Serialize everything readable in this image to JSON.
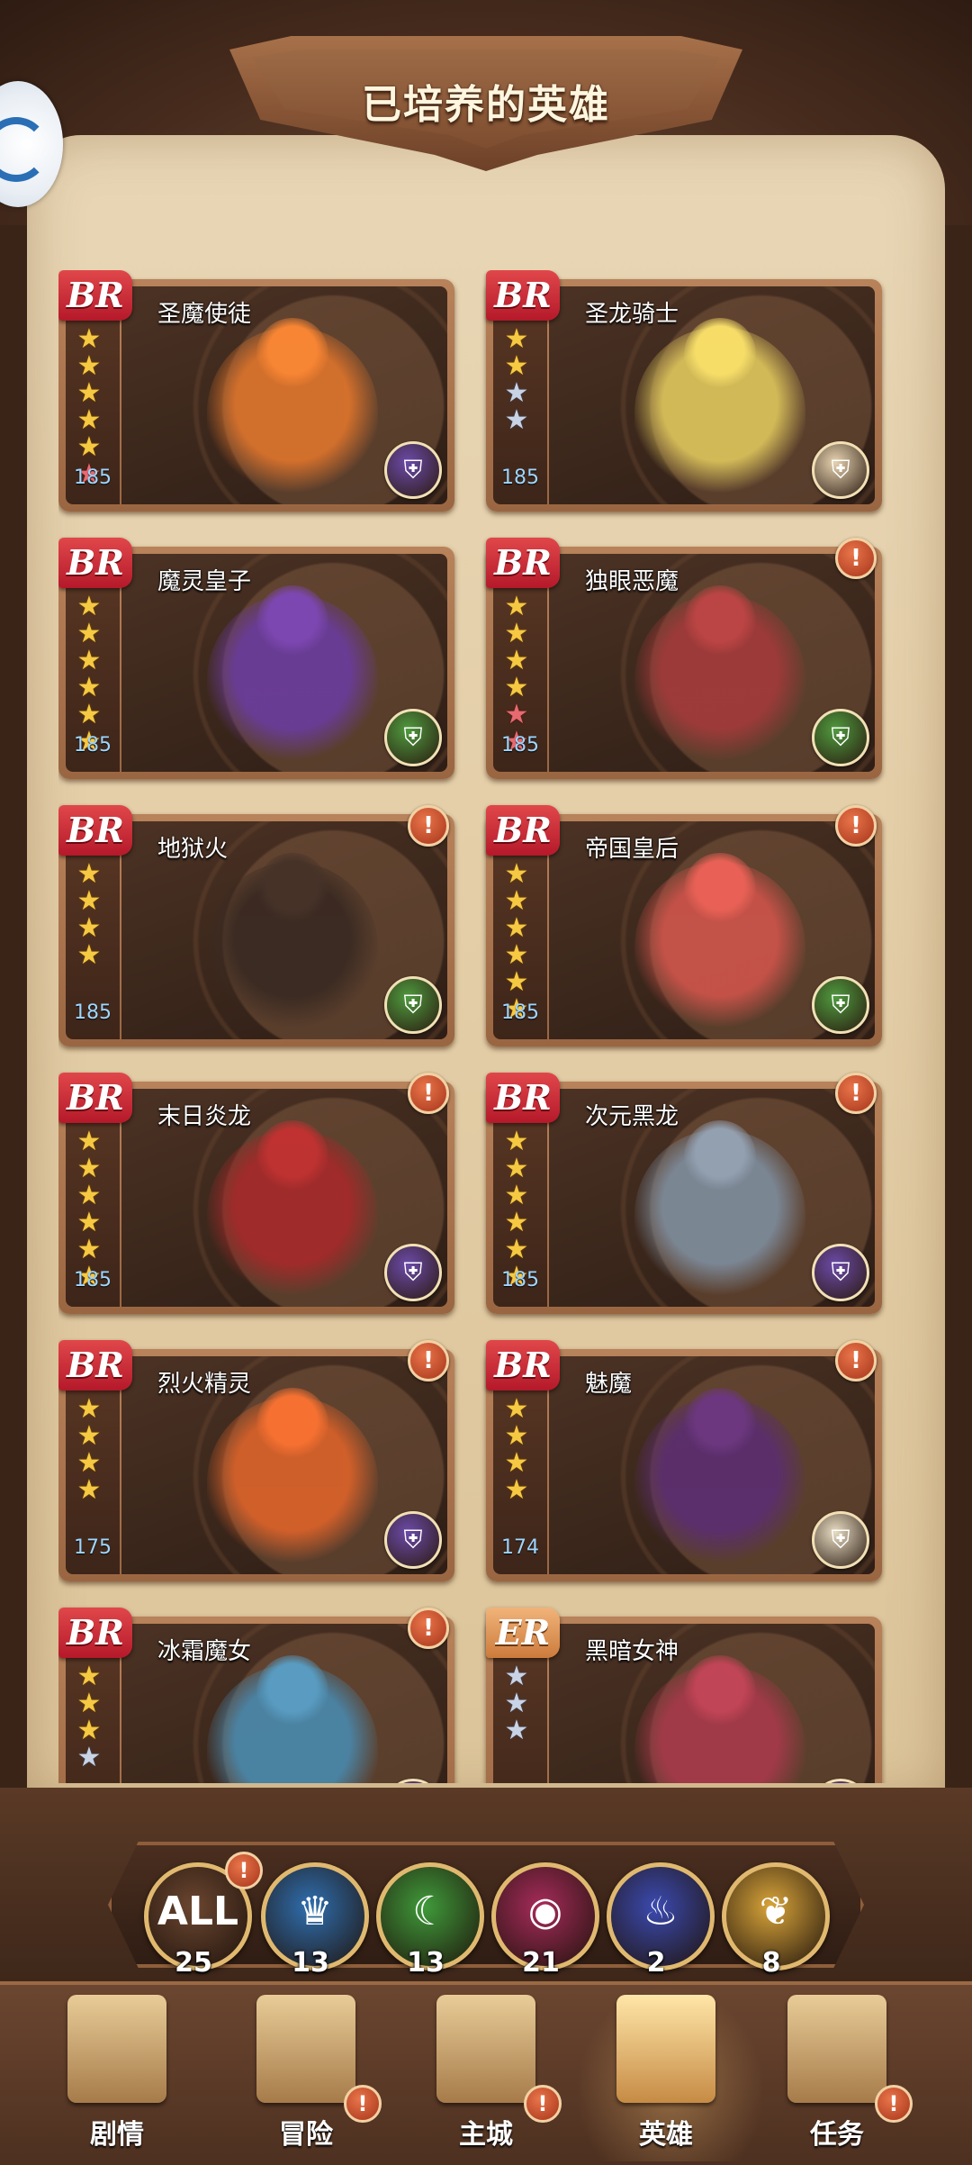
{
  "page_title": "已培养的英雄",
  "heroes": [
    {
      "rank": "BR",
      "name": "圣魔使徒",
      "stars": [
        "gold",
        "gold",
        "gold",
        "gold",
        "gold",
        "red"
      ],
      "level": "185",
      "class_icon": "helmet-icon",
      "class_color": "#6b4aa8",
      "alert": false,
      "art_color": "#d8722c"
    },
    {
      "rank": "BR",
      "name": "圣龙骑士",
      "stars": [
        "gold",
        "gold",
        "silver",
        "silver"
      ],
      "level": "185",
      "class_icon": "cannon-icon",
      "class_color": "#e7d3b0",
      "alert": false,
      "art_color": "#d8c05a"
    },
    {
      "rank": "BR",
      "name": "魔灵皇子",
      "stars": [
        "gold",
        "gold",
        "gold",
        "gold",
        "gold",
        "gold"
      ],
      "level": "185",
      "class_icon": "helmet-icon",
      "class_color": "#4f9a3e",
      "alert": false,
      "art_color": "#6a3c9a"
    },
    {
      "rank": "BR",
      "name": "独眼恶魔",
      "stars": [
        "gold",
        "gold",
        "gold",
        "gold",
        "red",
        "red"
      ],
      "level": "185",
      "class_icon": "helmet-icon",
      "class_color": "#4f9a3e",
      "alert": true,
      "art_color": "#a03a3a"
    },
    {
      "rank": "BR",
      "name": "地狱火",
      "stars": [
        "gold",
        "gold",
        "gold",
        "gold"
      ],
      "level": "185",
      "class_icon": "helmet-icon",
      "class_color": "#4f9a3e",
      "alert": true,
      "art_color": "#3a2a22"
    },
    {
      "rank": "BR",
      "name": "帝国皇后",
      "stars": [
        "gold",
        "gold",
        "gold",
        "gold",
        "gold",
        "gold"
      ],
      "level": "185",
      "class_icon": "helmet-icon",
      "class_color": "#4f9a3e",
      "alert": true,
      "art_color": "#c9534a"
    },
    {
      "rank": "BR",
      "name": "末日炎龙",
      "stars": [
        "gold",
        "gold",
        "gold",
        "gold",
        "gold",
        "gold"
      ],
      "level": "185",
      "class_icon": "helmet-icon",
      "class_color": "#6b4aa8",
      "alert": true,
      "art_color": "#a32a2a"
    },
    {
      "rank": "BR",
      "name": "次元黑龙",
      "stars": [
        "gold",
        "gold",
        "gold",
        "gold",
        "gold",
        "gold"
      ],
      "level": "185",
      "class_icon": "helmet-icon",
      "class_color": "#6b4aa8",
      "alert": true,
      "art_color": "#7d8a99"
    },
    {
      "rank": "BR",
      "name": "烈火精灵",
      "stars": [
        "gold",
        "gold",
        "gold",
        "gold"
      ],
      "level": "175",
      "class_icon": "helmet-icon",
      "class_color": "#6b4aa8",
      "alert": true,
      "art_color": "#d6612a"
    },
    {
      "rank": "BR",
      "name": "魅魔",
      "stars": [
        "gold",
        "gold",
        "gold",
        "gold"
      ],
      "level": "174",
      "class_icon": "hood-icon",
      "class_color": "#e8dcc2",
      "alert": true,
      "art_color": "#5b2e6e"
    },
    {
      "rank": "BR",
      "name": "冰霜魔女",
      "stars": [
        "gold",
        "gold",
        "gold",
        "silver"
      ],
      "level": "",
      "class_icon": "helmet-icon",
      "class_color": "#6b4aa8",
      "alert": true,
      "art_color": "#4a86a8"
    },
    {
      "rank": "ER",
      "name": "黑暗女神",
      "stars": [
        "silver",
        "silver",
        "silver"
      ],
      "level": "",
      "class_icon": "helmet-icon",
      "class_color": "#6b4aa8",
      "alert": false,
      "art_color": "#a53a4a"
    }
  ],
  "filters": [
    {
      "label": "ALL",
      "count": "25",
      "icon": "all-icon",
      "color": "#6b4630"
    },
    {
      "label": "",
      "count": "13",
      "icon": "crown-icon",
      "color": "#2f6fb0"
    },
    {
      "label": "",
      "count": "13",
      "icon": "moon-icon",
      "color": "#3f9a3a"
    },
    {
      "label": "",
      "count": "21",
      "icon": "eye-icon",
      "color": "#a62b5a"
    },
    {
      "label": "",
      "count": "2",
      "icon": "ghost-icon",
      "color": "#3b4ab0"
    },
    {
      "label": "",
      "count": "8",
      "icon": "wings-icon",
      "color": "#d9a53a"
    }
  ],
  "nav": [
    {
      "label": "剧情",
      "icon": "book-icon",
      "badge": false,
      "active": false
    },
    {
      "label": "冒险",
      "icon": "shield-icon",
      "badge": true,
      "active": false
    },
    {
      "label": "主城",
      "icon": "castle-icon",
      "badge": true,
      "active": false
    },
    {
      "label": "英雄",
      "icon": "helmet-icon",
      "badge": false,
      "active": true
    },
    {
      "label": "任务",
      "icon": "map-icon",
      "badge": true,
      "active": false
    }
  ]
}
